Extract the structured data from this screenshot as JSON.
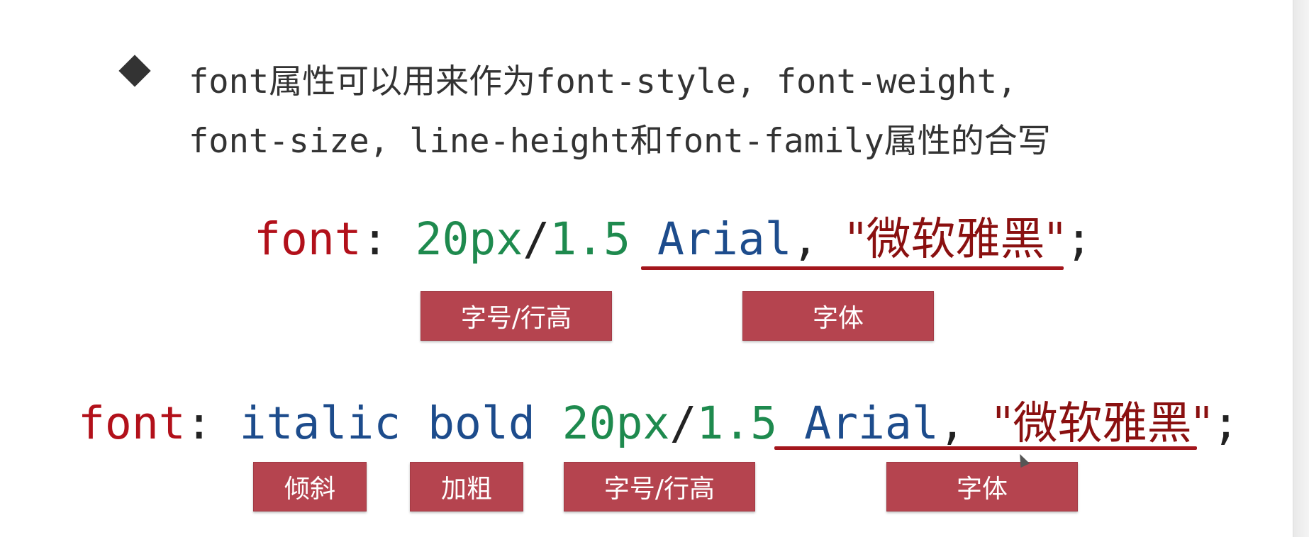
{
  "description": {
    "line1": "font属性可以用来作为font-style, font-weight,",
    "line2": "font-size, line-height和font-family属性的合写"
  },
  "example1": {
    "prop": "font",
    "colon": ": ",
    "size": "20px",
    "slash": "/",
    "line_height": "1.5",
    "family": "Arial",
    "comma": ", ",
    "family_cn": "\"微软雅黑\"",
    "semicolon": ";",
    "tags": {
      "size_line_height": "字号/行高",
      "family": "字体"
    }
  },
  "example2": {
    "prop": "font",
    "colon": ": ",
    "style": "italic",
    "weight": "bold",
    "size": "20px",
    "slash": "/",
    "line_height": "1.5",
    "family": "Arial",
    "comma": ", ",
    "family_cn": "\"微软雅黑\"",
    "semicolon": ";",
    "tags": {
      "italic": "倾斜",
      "bold": "加粗",
      "size_line_height": "字号/行高",
      "family": "字体"
    }
  },
  "colors": {
    "property": "#b2101a",
    "number": "#1e8a4e",
    "keyword": "#1d4c8c",
    "string": "#8a1010",
    "tag_background": "#b5444f",
    "underline": "#a3161c"
  }
}
